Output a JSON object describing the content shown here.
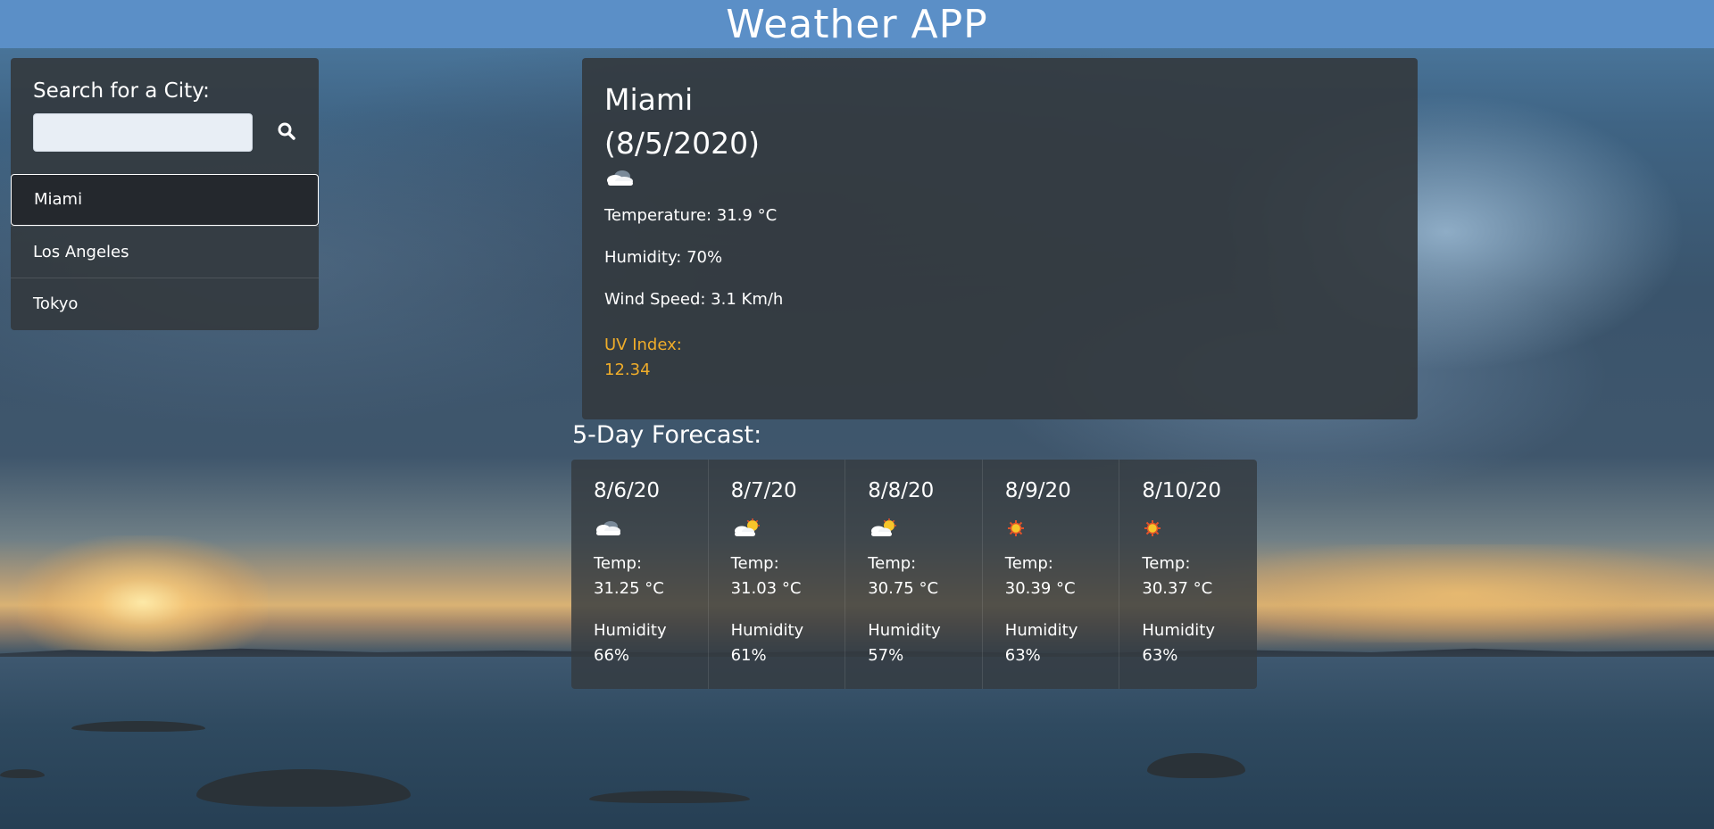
{
  "header": {
    "title": "Weather APP"
  },
  "search": {
    "label": "Search for a City:",
    "input_value": "",
    "placeholder": ""
  },
  "cities": [
    {
      "name": "Miami",
      "active": true
    },
    {
      "name": "Los Angeles",
      "active": false
    },
    {
      "name": "Tokyo",
      "active": false
    }
  ],
  "current": {
    "city": "Miami",
    "date": "(8/5/2020)",
    "icon": "cloud-icon",
    "temperature": "Temperature: 31.9 °C",
    "humidity": "Humidity: 70%",
    "wind": "Wind Speed: 3.1 Km/h",
    "uv_label": "UV Index:",
    "uv_value": "12.34",
    "uv_color": "#f0ad2a"
  },
  "forecast": {
    "heading": "5-Day Forecast:",
    "days": [
      {
        "date": "8/6/20",
        "icon": "cloud-icon",
        "temp_label": "Temp:",
        "temp": "31.25 °C",
        "humidity_label": "Humidity",
        "humidity": "66%"
      },
      {
        "date": "8/7/20",
        "icon": "sun-behind-cloud-icon",
        "temp_label": "Temp:",
        "temp": "31.03 °C",
        "humidity_label": "Humidity",
        "humidity": "61%"
      },
      {
        "date": "8/8/20",
        "icon": "sun-behind-cloud-icon",
        "temp_label": "Temp:",
        "temp": "30.75 °C",
        "humidity_label": "Humidity",
        "humidity": "57%"
      },
      {
        "date": "8/9/20",
        "icon": "sun-icon",
        "temp_label": "Temp:",
        "temp": "30.39 °C",
        "humidity_label": "Humidity",
        "humidity": "63%"
      },
      {
        "date": "8/10/20",
        "icon": "sun-icon",
        "temp_label": "Temp:",
        "temp": "30.37 °C",
        "humidity_label": "Humidity",
        "humidity": "63%"
      }
    ]
  },
  "colors": {
    "header_bg": "#5b8fc7",
    "panel_bg": "#343a40",
    "uv_accent": "#f0ad2a"
  }
}
